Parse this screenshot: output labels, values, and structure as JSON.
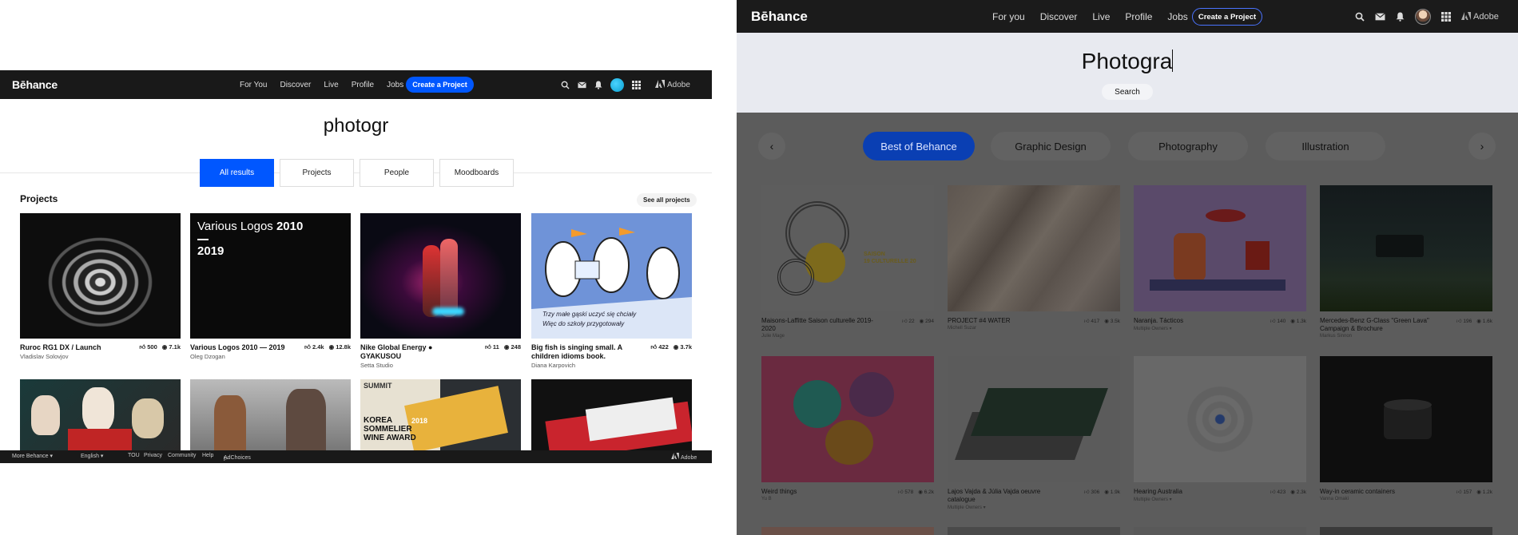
{
  "left": {
    "header": {
      "logo": "Bēhance",
      "nav": [
        "For You",
        "Discover",
        "Live",
        "Profile",
        "Jobs"
      ],
      "create_button": "Create a Project",
      "adobe": "Adobe"
    },
    "search_query": "photogr",
    "tabs": [
      "All results",
      "Projects",
      "People",
      "Moodboards"
    ],
    "active_tab": "All results",
    "section": {
      "title": "Projects",
      "see_all": "See all projects"
    },
    "projects": [
      {
        "title": "Ruroc RG1 DX / Launch",
        "owner": "Vladislav Solovjov",
        "likes": "500",
        "views": "7.1k"
      },
      {
        "title": "Various Logos 2010 — 2019",
        "owner": "Oleg Dzogan",
        "likes": "2.4k",
        "views": "12.8k"
      },
      {
        "title": "Nike Global Energy ● GYAKUSOU",
        "owner": "Setta Studio",
        "likes": "11",
        "views": "248"
      },
      {
        "title": "Big fish is singing small. A children idioms book.",
        "owner": "Diana Karpovich",
        "likes": "422",
        "views": "3.7k"
      }
    ],
    "thumb_texts": {
      "logos_line1": "Various Logos",
      "logos_year1": "2010",
      "logos_year2": "2019",
      "book_caption1": "Trzy małe gąski uczyć się chciały",
      "book_caption2": "Więc do szkoły przygotowały",
      "korea_line1": "KOREA",
      "korea_line2": "SOMMELIER",
      "korea_line3": "WINE AWARD",
      "korea_year": "2018",
      "summit": "SUMMIT"
    },
    "footer": {
      "more": "More Behance ▾",
      "lang": "English ▾",
      "links": [
        "TOU",
        "Privacy",
        "Community",
        "Help"
      ],
      "adchoices": "AdChoices",
      "adobe": "Adobe"
    }
  },
  "right": {
    "header": {
      "logo": "Bēhance",
      "nav": [
        "For you",
        "Discover",
        "Live",
        "Profile",
        "Jobs"
      ],
      "create_button": "Create a Project",
      "adobe": "Adobe"
    },
    "search_query": "Photogra",
    "search_button": "Search",
    "categories": [
      "Best of Behance",
      "Graphic Design",
      "Photography",
      "Illustration"
    ],
    "active_category": "Best of Behance",
    "projects": [
      {
        "title": "Maisons-Laffitte Saison culturelle 2019-2020",
        "owner": "Julie Mage",
        "likes": "22",
        "views": "294"
      },
      {
        "title": "PROJECT #4 WATER",
        "owner": "Michell Suzar",
        "likes": "417",
        "views": "3.5k"
      },
      {
        "title": "Naranja. Tácticos",
        "owner": "Multiple Owners ▾",
        "likes": "140",
        "views": "1.3k"
      },
      {
        "title": "Mercedes-Benz G-Class \"Green Lava\" Campaign & Brochure",
        "owner": "Markus Sinnon",
        "likes": "196",
        "views": "1.6k"
      },
      {
        "title": "Weird things",
        "owner": "Yu B",
        "likes": "578",
        "views": "6.2k"
      },
      {
        "title": "Lajos Vajda & Júlia Vajda oeuvre catalogue",
        "owner": "Multiple Owners ▾",
        "likes": "306",
        "views": "1.9k"
      },
      {
        "title": "Hearing Australia",
        "owner": "Multiple Owners ▾",
        "likes": "423",
        "views": "2.3k"
      },
      {
        "title": "Way-in ceramic containers",
        "owner": "Vanna Omaki",
        "likes": "157",
        "views": "1.2k"
      }
    ],
    "thumb_texts": {
      "saison": "SAISON",
      "saison_years": "19 CULTURELLE 20"
    }
  }
}
